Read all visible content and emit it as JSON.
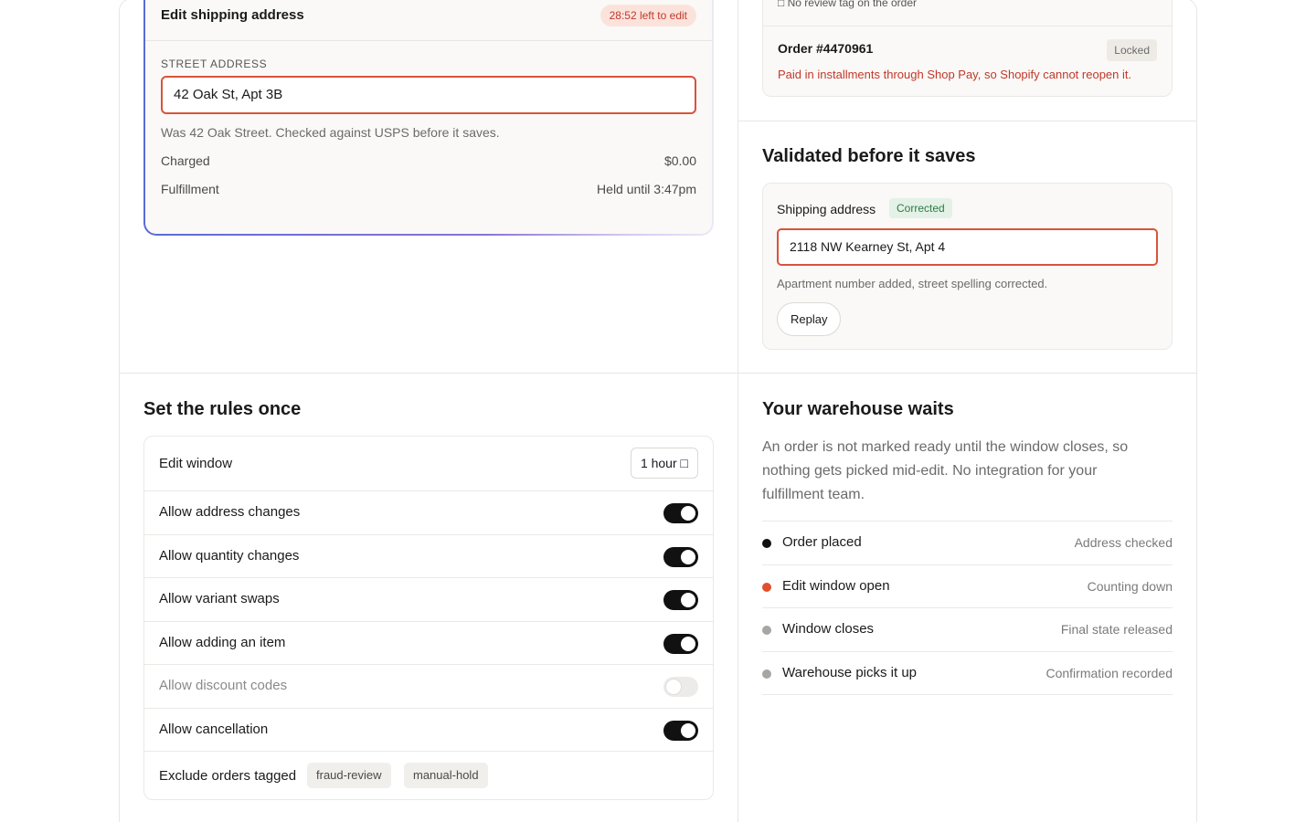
{
  "edit_card": {
    "title": "Edit shipping address",
    "timer": "28:52 left to edit",
    "street_label": "STREET ADDRESS",
    "street_value": "42 Oak St, Apt 3B",
    "hint": "Was 42 Oak Street. Checked against USPS before it saves.",
    "charged_label": "Charged",
    "charged_value": "$0.00",
    "fulfillment_label": "Fulfillment",
    "fulfillment_value": "Held until 3:47pm"
  },
  "order_card": {
    "tag_line": "No review tag on the order",
    "order_number": "Order #4470961",
    "status": "Locked",
    "note": "Paid in installments through Shop Pay, so Shopify cannot reopen it."
  },
  "validated": {
    "title": "Validated before it saves",
    "field_label": "Shipping address",
    "badge": "Corrected",
    "value": "2118 NW Kearney St, Apt 4",
    "hint": "Apartment number added, street spelling corrected.",
    "replay_label": "Replay"
  },
  "rules": {
    "title": "Set the rules once",
    "edit_window_label": "Edit window",
    "edit_window_value": "1 hour",
    "toggles": [
      {
        "label": "Allow address changes",
        "on": true
      },
      {
        "label": "Allow quantity changes",
        "on": true
      },
      {
        "label": "Allow variant swaps",
        "on": true
      },
      {
        "label": "Allow adding an item",
        "on": true
      },
      {
        "label": "Allow discount codes",
        "on": false
      },
      {
        "label": "Allow cancellation",
        "on": true
      }
    ],
    "exclude_label": "Exclude orders tagged",
    "exclude_tags": [
      "fraud-review",
      "manual-hold"
    ]
  },
  "warehouse": {
    "title": "Your warehouse waits",
    "description": "An order is not marked ready until the window closes, so nothing gets picked mid-edit. No integration for your fulfillment team.",
    "steps": [
      {
        "name": "Order placed",
        "status": "Address checked",
        "color": "#111111"
      },
      {
        "name": "Edit window open",
        "status": "Counting down",
        "color": "#e0502f"
      },
      {
        "name": "Window closes",
        "status": "Final state released",
        "color": "#a8a6a2"
      },
      {
        "name": "Warehouse picks it up",
        "status": "Confirmation recorded",
        "color": "#a8a6a2"
      }
    ]
  }
}
